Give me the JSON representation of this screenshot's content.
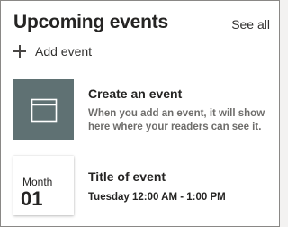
{
  "header": {
    "title": "Upcoming events",
    "see_all": "See all"
  },
  "add_event": {
    "label": "Add event",
    "icon": "plus-icon"
  },
  "create_card": {
    "icon": "calendar-icon",
    "thumb_color": "#5f7173",
    "title": "Create an event",
    "description": "When you add an event, it will show here where your readers can see it."
  },
  "event": {
    "month": "Month",
    "day": "01",
    "title": "Title of event",
    "time": "Tuesday 12:00 AM - 1:00 PM"
  }
}
